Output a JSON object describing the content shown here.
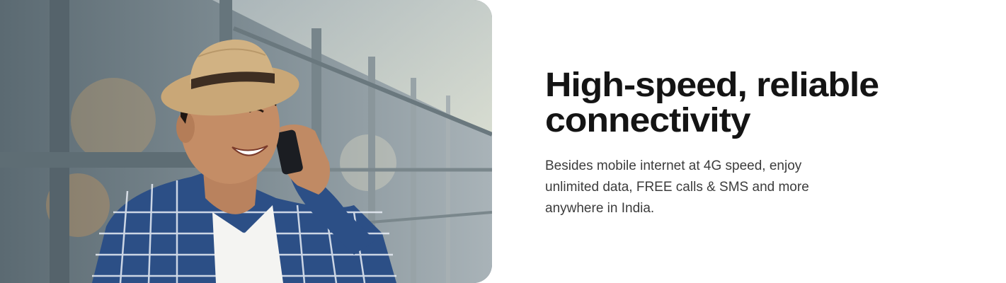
{
  "banner": {
    "headline_line1": "High-speed, reliable",
    "headline_line2": "connectivity",
    "body_line1": "Besides mobile internet at 4G speed, enjoy",
    "body_line2": "unlimited data, FREE calls & SMS and more",
    "body_line3": "anywhere in India."
  },
  "colors": {
    "headline": "#141414",
    "body": "#3c3c3c",
    "background": "#ffffff"
  }
}
